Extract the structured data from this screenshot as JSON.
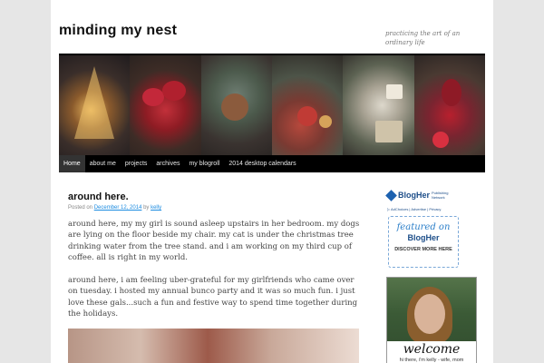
{
  "site": {
    "title": "minding my nest",
    "description": "practicing the art of an ordinary life"
  },
  "header_image": {
    "panels": [
      "christmas-tree-photo",
      "poinsettia-photo",
      "pinecone-wreath-photo",
      "ornaments-photo",
      "gift-bottles-photo",
      "red-ornament-photo"
    ]
  },
  "nav": {
    "items": [
      {
        "label": "Home"
      },
      {
        "label": "about me"
      },
      {
        "label": "projects"
      },
      {
        "label": "archives"
      },
      {
        "label": "my blogroll"
      },
      {
        "label": "2014 desktop calendars"
      }
    ]
  },
  "post": {
    "title": "around here.",
    "meta_posted_on": "Posted on",
    "meta_date": "December 12, 2014",
    "meta_by": "by",
    "meta_author": "kelly",
    "paragraphs": [
      "around here, my my girl is sound asleep upstairs in her bedroom.  my dogs are lying on the floor beside my chair.  my cat is under the christmas tree drinking water from the tree stand.  and i am working on my third cup of coffee.  all is right in my world.",
      "around here, i am feeling uber-grateful for my girlfriends who came over on tuesday.  i hosted my annual bunco party and it was so much fun.  i just love these gals...such a fun and festive way to spend time together during the holidays."
    ]
  },
  "sidebar": {
    "blogher_logo": "BlogHer",
    "blogher_sub": "Publishing Network",
    "ad_choices": "AdChoices",
    "advertise": "Advertise",
    "privacy": "Privacy",
    "badge_featured": "featured on",
    "badge_brand": "BlogHer",
    "badge_discover": "DISCOVER MORE HERE",
    "welcome": "welcome",
    "welcome_line": "hi there, i'm kelly - wife, mom"
  },
  "colors": {
    "nav_bg": "#000000",
    "link": "#1b8be0",
    "blogher_blue": "#1d4e89"
  }
}
